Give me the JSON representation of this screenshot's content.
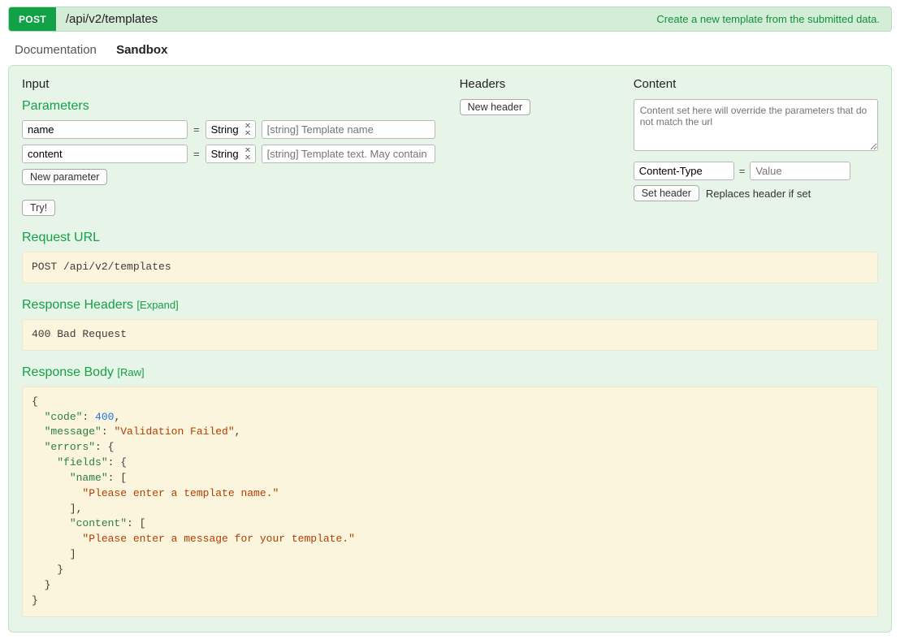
{
  "endpoint": {
    "method": "POST",
    "path": "/api/v2/templates",
    "summary": "Create a new template from the submitted data."
  },
  "tabs": {
    "documentation": "Documentation",
    "sandbox": "Sandbox"
  },
  "input": {
    "title": "Input",
    "parameters_title": "Parameters",
    "params": [
      {
        "name": "name",
        "type": "String",
        "placeholder": "[string] Template name"
      },
      {
        "name": "content",
        "type": "String",
        "placeholder": "[string] Template text. May contain tags"
      }
    ],
    "new_param_btn": "New parameter",
    "try_btn": "Try!"
  },
  "headers": {
    "title": "Headers",
    "new_header_btn": "New header"
  },
  "content": {
    "title": "Content",
    "placeholder": "Content set here will override the parameters that do not match the url",
    "header_key_default": "Content-Type",
    "header_val_placeholder": "Value",
    "set_header_btn": "Set header",
    "hint": "Replaces header if set"
  },
  "request_url": {
    "title": "Request URL",
    "value": "POST /api/v2/templates"
  },
  "response_headers": {
    "title": "Response Headers",
    "expand_label": "[Expand]",
    "value": "400 Bad Request"
  },
  "response_body": {
    "title": "Response Body",
    "raw_label": "[Raw]",
    "json": {
      "code": 400,
      "message": "Validation Failed",
      "errors": {
        "fields": {
          "name": [
            "Please enter a template name."
          ],
          "content": [
            "Please enter a message for your template."
          ]
        }
      }
    }
  }
}
